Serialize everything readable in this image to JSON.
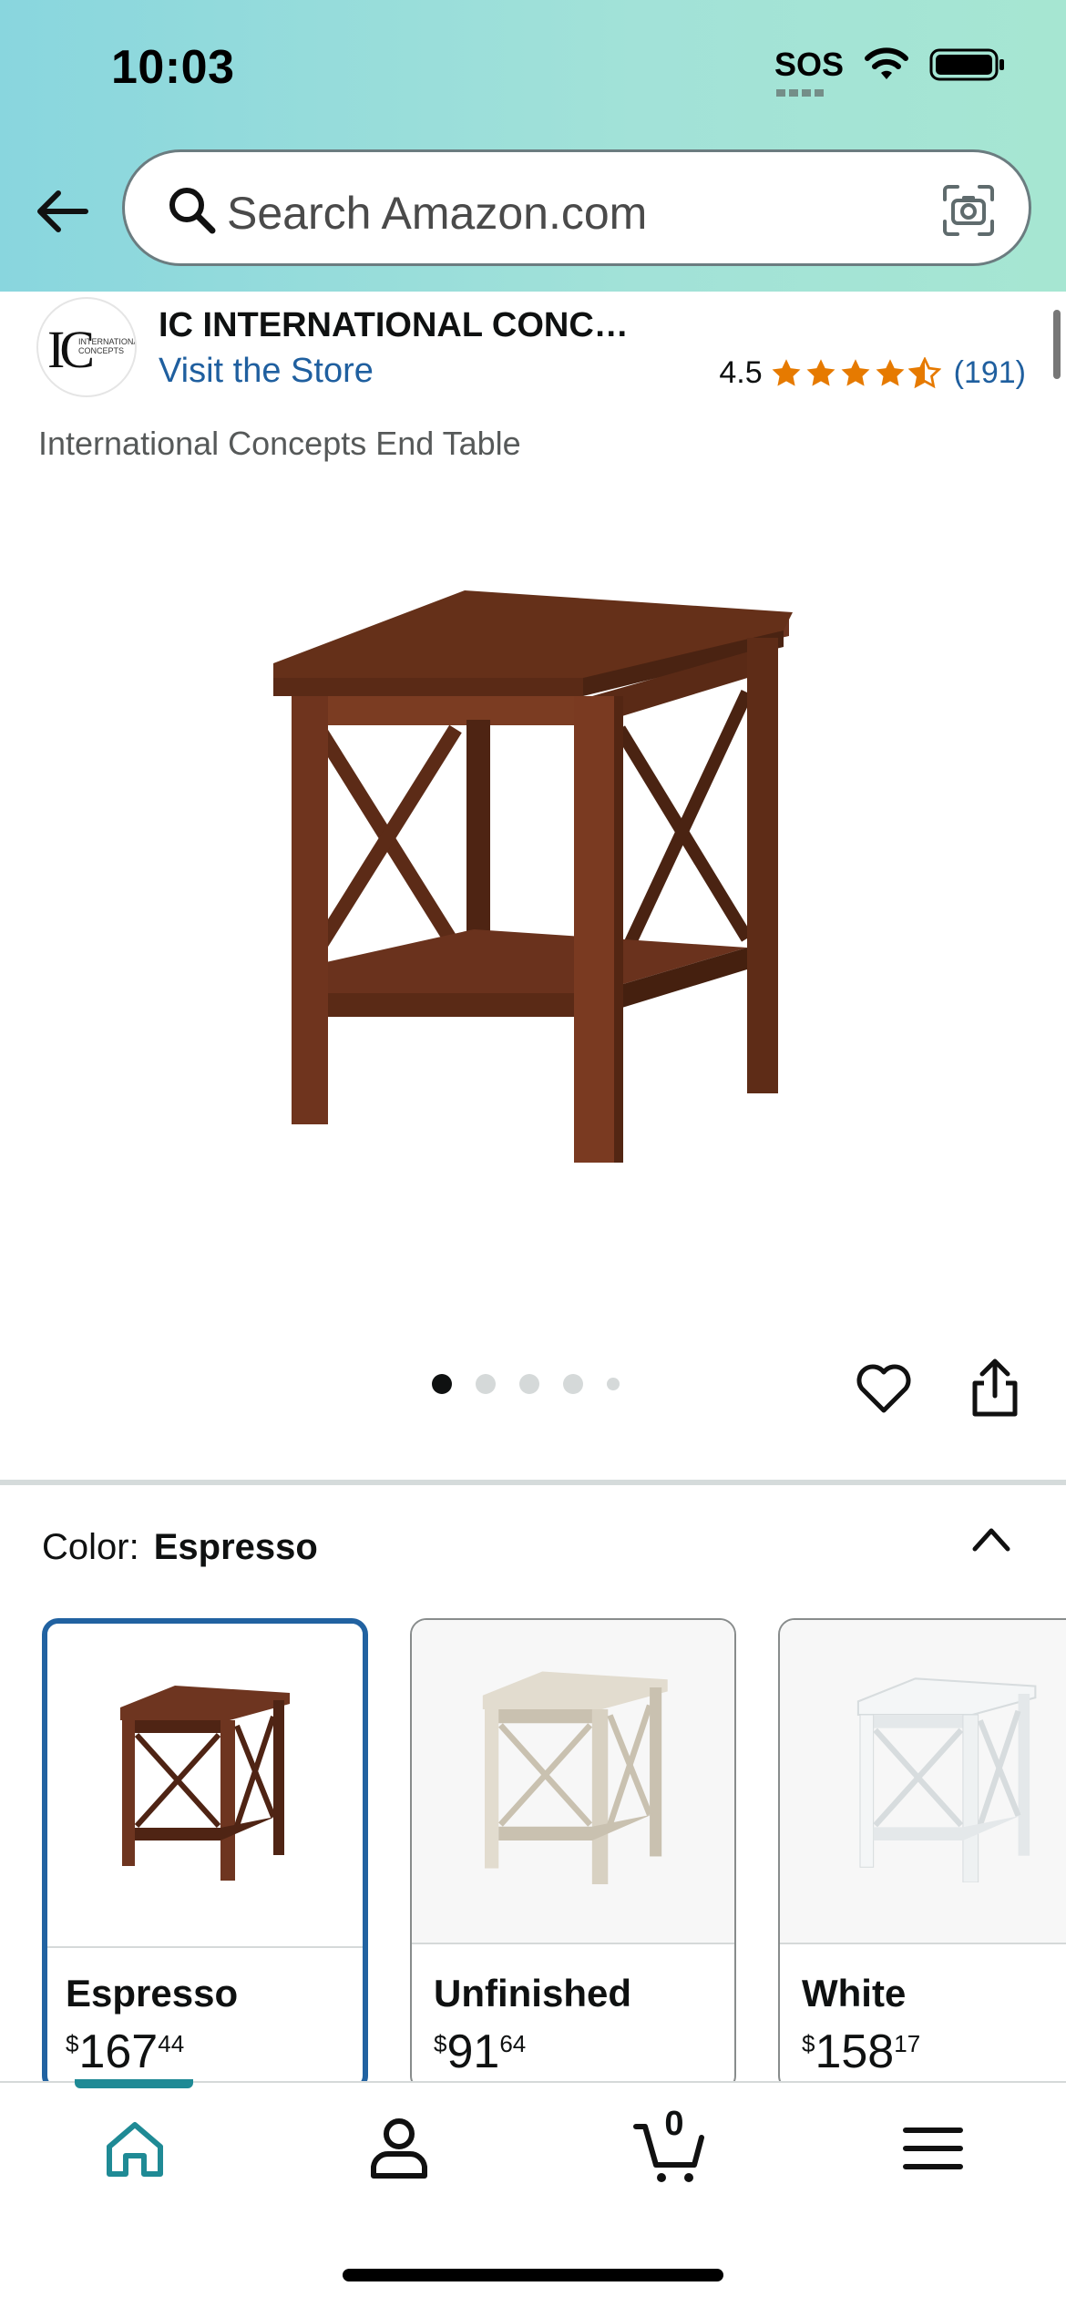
{
  "status_bar": {
    "time": "10:03",
    "sos": "SOS"
  },
  "search": {
    "placeholder": "Search Amazon.com"
  },
  "store": {
    "logo_text": "IC",
    "logo_subtext": "INTERNATIONAL CONCEPTS",
    "brand": "IC INTERNATIONAL CONC…",
    "visit_label": "Visit the Store",
    "rating": "4.5",
    "rating_count": "(191)",
    "stars_value": 4.5
  },
  "product": {
    "title": "International Concepts End Table",
    "image_count": 5,
    "active_image": 1
  },
  "color": {
    "label": "Color:",
    "selected": "Espresso",
    "options": [
      {
        "name": "Espresso",
        "currency": "$",
        "whole": "167",
        "fraction": "44",
        "wood": "#6e3520",
        "wood_dark": "#4f2414",
        "selected": true
      },
      {
        "name": "Unfinished",
        "currency": "$",
        "whole": "91",
        "fraction": "64",
        "wood": "#e2dccf",
        "wood_dark": "#c9c1b0",
        "selected": false
      },
      {
        "name": "White",
        "currency": "$",
        "whole": "158",
        "fraction": "17",
        "wood": "#f4f6f7",
        "wood_dark": "#d7dcde",
        "selected": false
      }
    ]
  },
  "nav": {
    "cart_count": "0",
    "items": [
      "home-icon",
      "account-icon",
      "cart-icon",
      "menu-icon"
    ],
    "active": "home-icon"
  },
  "colors": {
    "link": "#1f5f9f",
    "star": "#e67a00",
    "selected_border": "#2162a1",
    "nav_active": "#1f8a95"
  }
}
